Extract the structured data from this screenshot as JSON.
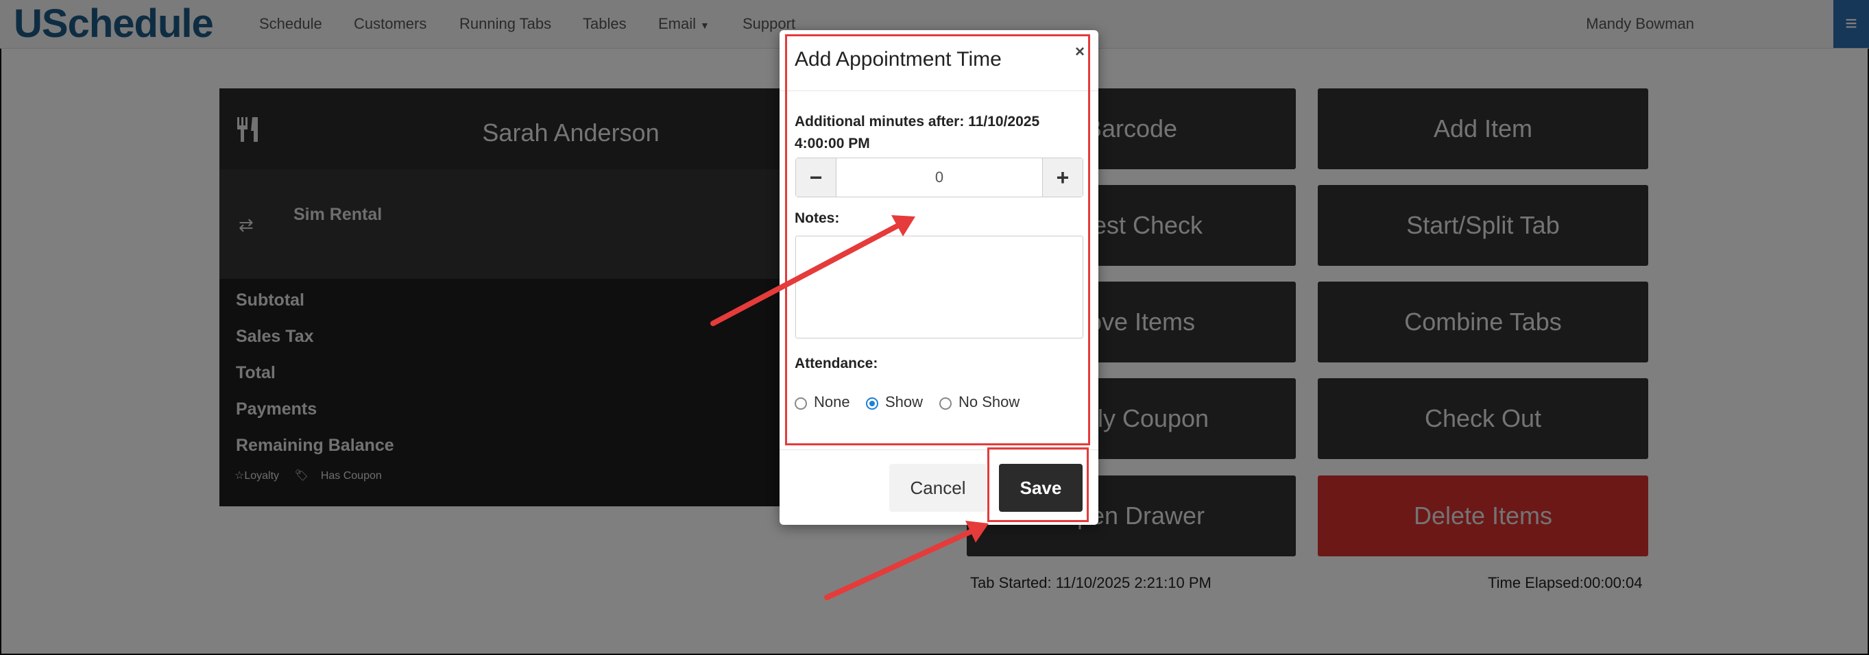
{
  "nav": {
    "brand": "USchedule",
    "items": [
      "Schedule",
      "Customers",
      "Running Tabs",
      "Tables",
      "Email",
      "Support"
    ],
    "user": "Mandy Bowman"
  },
  "tab": {
    "customer": "Sarah Anderson",
    "line_item": "Sim Rental",
    "summary": [
      "Subtotal",
      "Sales Tax",
      "Total",
      "Payments",
      "Remaining Balance"
    ],
    "badges": [
      "☆Loyalty",
      "Has Coupon"
    ]
  },
  "actions": {
    "left": [
      "Barcode",
      "Guest Check",
      "Move Items",
      "Apply Coupon",
      "Open Drawer"
    ],
    "right": [
      "Add Item",
      "Start/Split Tab",
      "Combine Tabs",
      "Check Out",
      "Delete Items"
    ]
  },
  "footer": {
    "tab_started": "Tab Started: 11/10/2025 2:21:10 PM",
    "time_elapsed": "Time Elapsed:00:00:04"
  },
  "modal": {
    "title": "Add Appointment Time",
    "close": "×",
    "additional_label": "Additional minutes after: 11/10/2025 4:00:00 PM",
    "stepper_minus": "−",
    "stepper_value": "0",
    "stepper_plus": "+",
    "notes_label": "Notes:",
    "notes_value": "",
    "attendance_label": "Attendance:",
    "attendance_options": [
      "None",
      "Show",
      "No Show"
    ],
    "attendance_selected": "Show",
    "cancel": "Cancel",
    "save": "Save"
  },
  "colors": {
    "brand": "#1d5a87",
    "panel": "#1e1e1e",
    "button": "#333333",
    "delete": "#d9302e",
    "highlight": "#e53b3b"
  }
}
